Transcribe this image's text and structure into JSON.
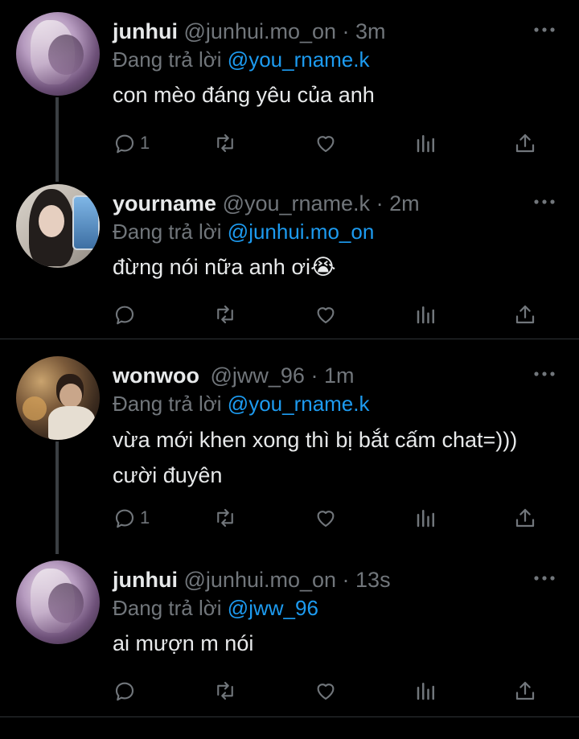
{
  "reply_prefix": "Đang trả lời",
  "colors": {
    "background": "#000000",
    "text": "#e7e9ea",
    "muted": "#71767b",
    "accent": "#1d9bf0",
    "divider": "#2f3336"
  },
  "tweets": [
    {
      "name": "junhui",
      "handle": "@junhui.mo_on",
      "time": "· 3m",
      "reply_to": "@you_rname.k",
      "text": "con mèo đáng yêu của anh",
      "reply_count": "1"
    },
    {
      "name": "yourname",
      "handle": "@you_rname.k",
      "time": "· 2m",
      "reply_to": "@junhui.mo_on",
      "text": "đừng nói nữa anh ơi😭",
      "reply_count": ""
    },
    {
      "name": "wonwoo",
      "handle": "@jww_96",
      "time": "· 1m",
      "reply_to": "@you_rname.k",
      "text": "vừa mới khen xong thì bị bắt cấm chat=))) cười đuyên",
      "reply_count": "1"
    },
    {
      "name": "junhui",
      "handle": "@junhui.mo_on",
      "time": "· 13s",
      "reply_to": "@jww_96",
      "text": "ai mượn m nói",
      "reply_count": ""
    }
  ],
  "icons": [
    "reply-icon",
    "retweet-icon",
    "like-icon",
    "analytics-icon",
    "share-icon",
    "more-icon"
  ]
}
